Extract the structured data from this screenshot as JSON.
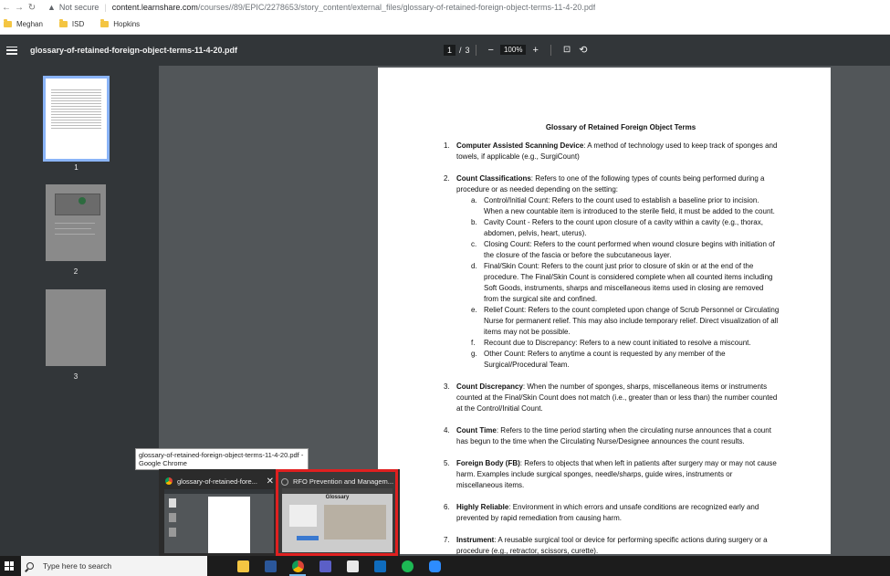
{
  "browser": {
    "not_secure": "Not secure",
    "url_host": "content.learnshare.com",
    "url_path": "/courses//89/EPIC/2278653/story_content/external_files/glossary-of-retained-foreign-object-terms-11-4-20.pdf",
    "bookmarks": [
      {
        "label": "Meghan"
      },
      {
        "label": "ISD"
      },
      {
        "label": "Hopkins"
      }
    ]
  },
  "pdf_toolbar": {
    "file_name": "glossary-of-retained-foreign-object-terms-11-4-20.pdf",
    "current_page": "1",
    "page_sep": "/",
    "total_pages": "3",
    "zoom": "100%"
  },
  "thumbnails": [
    {
      "label": "1"
    },
    {
      "label": "2"
    },
    {
      "label": "3"
    }
  ],
  "document": {
    "title": "Glossary of Retained Foreign Object Terms",
    "items": [
      {
        "n": "1.",
        "term": "Computer Assisted Scanning Device",
        "text": ":  A method of technology used to keep track of sponges and towels, if applicable (e.g., SurgiCount)"
      },
      {
        "n": "2.",
        "term": "Count Classifications",
        "text": ": Refers to one of the following types of counts being performed during a procedure or as needed depending on the setting:"
      },
      {
        "n": "3.",
        "term": "Count Discrepancy",
        "text": ":  When the number of sponges, sharps, miscellaneous items or instruments counted at the Final/Skin Count does not match (i.e., greater than or less than) the number counted at the Control/Initial Count."
      },
      {
        "n": "4.",
        "term": "Count Time",
        "text": ":  Refers to the time period starting when the circulating nurse announces that a count has begun to the time when the Circulating Nurse/Designee announces the count results."
      },
      {
        "n": "5.",
        "term": "Foreign Body (FB)",
        "text": ":  Refers to objects that when left in patients after surgery may or may not cause harm. Examples include surgical sponges, needle/sharps, guide wires, instruments or miscellaneous items."
      },
      {
        "n": "6.",
        "term": "Highly Reliable",
        "text": ": Environment in which errors and unsafe conditions are recognized early and prevented by rapid remediation from causing harm."
      },
      {
        "n": "7.",
        "term": "Instrument",
        "text": ": A reusable surgical tool or device for performing specific actions during surgery or a procedure (e.g., retractor, scissors, curette)."
      }
    ],
    "sub_items": [
      {
        "l": "a.",
        "text": "Control/Initial Count: Refers to the count used to establish a baseline prior to incision. When a new countable item is introduced to the sterile field, it must be added to the count."
      },
      {
        "l": "b.",
        "text": "Cavity Count - Refers to the count upon closure of a cavity within a cavity (e.g., thorax, abdomen, pelvis, heart, uterus)."
      },
      {
        "l": "c.",
        "text": "Closing Count: Refers to the count performed when wound closure begins with initiation of the closure of the fascia or before the subcutaneous layer."
      },
      {
        "l": "d.",
        "text": "Final/Skin Count: Refers to the count just prior to closure of skin or at the end of the procedure. The Final/Skin Count is considered complete when all counted items including Soft Goods, instruments, sharps and miscellaneous items used in closing are removed from the surgical site and confined."
      },
      {
        "l": "e.",
        "text": "Relief Count: Refers to the count completed upon change of Scrub Personnel or Circulating Nurse for permanent relief. This may also include temporary relief. Direct visualization of all items may not be possible."
      },
      {
        "l": "f.",
        "text": "Recount due to Discrepancy:  Refers to a new count initiated to resolve a miscount."
      },
      {
        "l": "g.",
        "text": "Other Count: Refers to anytime a count is requested by any member of the Surgical/Procedural Team."
      }
    ]
  },
  "taskbar_popup": {
    "tooltip": "glossary-of-retained-foreign-object-terms-11-4-20.pdf - Google Chrome",
    "preview1_title": "glossary-of-retained-fore...",
    "preview2_title": "RFO Prevention and Managem...",
    "preview2_heading": "Glossary"
  },
  "taskbar": {
    "search_placeholder": "Type here to search",
    "apps": [
      "file-explorer-icon",
      "word-icon",
      "chrome-icon",
      "teams-icon",
      "notepad-icon",
      "outlook-icon",
      "spotify-icon",
      "zoom-icon"
    ]
  }
}
